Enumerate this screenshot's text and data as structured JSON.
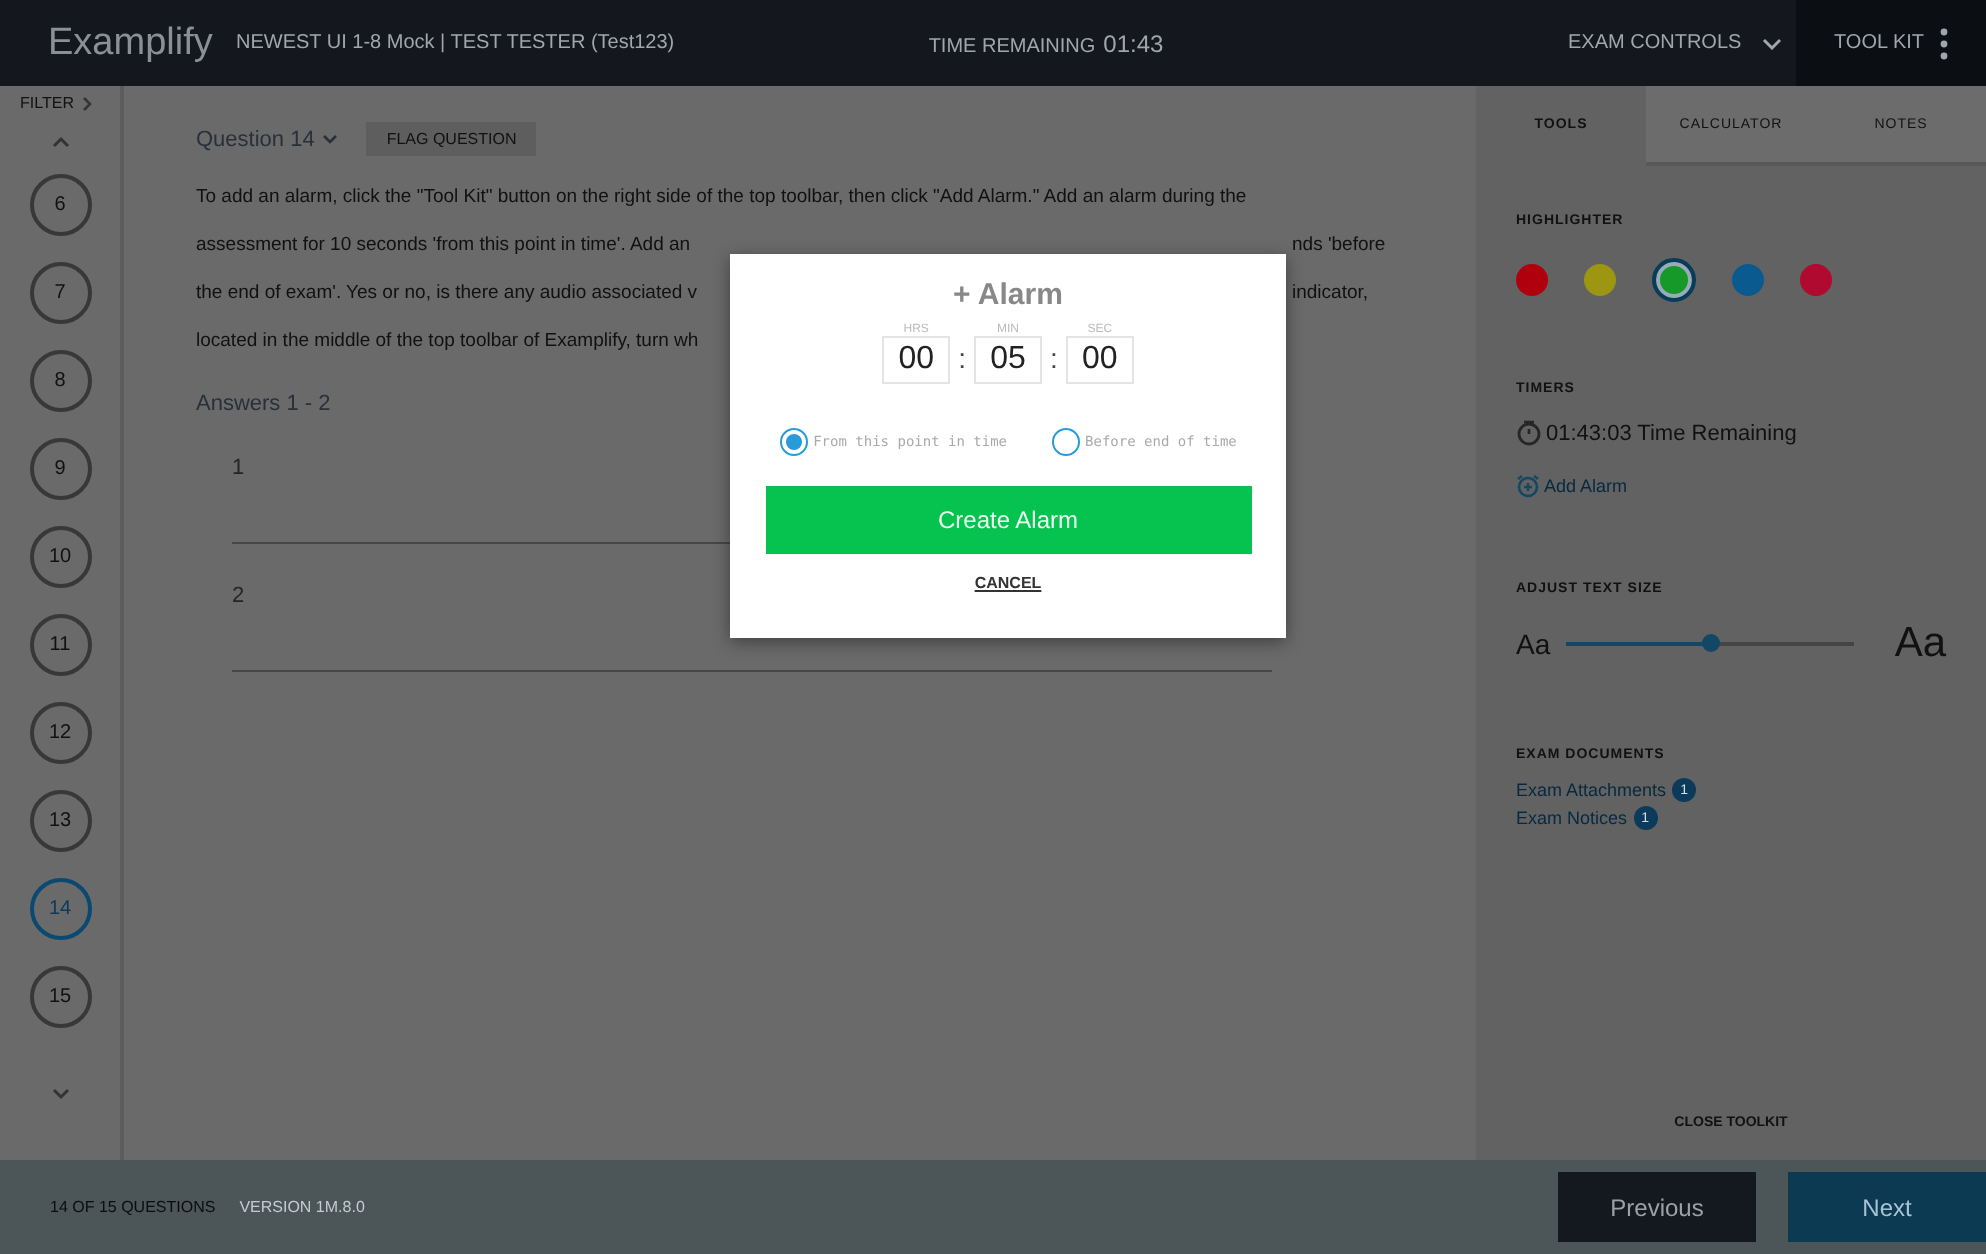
{
  "header": {
    "logo": "Examplify",
    "exam_title": "NEWEST UI 1-8 Mock | TEST TESTER (Test123)",
    "time_label": "TIME REMAINING",
    "time": "01:43",
    "exam_controls": "EXAM CONTROLS",
    "toolkit": "TOOL KIT"
  },
  "nav": {
    "filter": "FILTER",
    "questions": [
      {
        "number": "6",
        "selected": false
      },
      {
        "number": "7",
        "selected": false
      },
      {
        "number": "8",
        "selected": false
      },
      {
        "number": "9",
        "selected": false
      },
      {
        "number": "10",
        "selected": false
      },
      {
        "number": "11",
        "selected": false
      },
      {
        "number": "12",
        "selected": false
      },
      {
        "number": "13",
        "selected": false
      },
      {
        "number": "14",
        "selected": true
      },
      {
        "number": "15",
        "selected": false
      }
    ]
  },
  "question": {
    "title": "Question 14",
    "flag": "FLAG QUESTION",
    "lines": [
      {
        "left": "To add an alarm, click the \"Tool Kit\" button on the right side of the top toolbar, then click \"Add Alarm.\" Add an alarm during the"
      },
      {
        "left": "assessment for 10 seconds 'from this point in time'. Add an",
        "right": "nds 'before"
      },
      {
        "left": "the end of exam'. Yes or no, is there any audio associated v",
        "right": "indicator,"
      },
      {
        "left": "located in the middle of the top toolbar of Examplify, turn wh"
      }
    ],
    "answers_title": "Answers 1 - 2",
    "answers": [
      "1",
      "2"
    ]
  },
  "modal": {
    "title": "+ Alarm",
    "fields": [
      {
        "label": "HRS",
        "value": "00"
      },
      {
        "label": "MIN",
        "value": "05"
      },
      {
        "label": "SEC",
        "value": "00"
      }
    ],
    "separators": [
      ":",
      ":"
    ],
    "options": [
      {
        "label": "From this point in time",
        "selected": true
      },
      {
        "label": "Before end of time",
        "selected": false
      }
    ],
    "create": "Create Alarm",
    "cancel": "CANCEL"
  },
  "toolkit": {
    "tabs": [
      {
        "label": "TOOLS",
        "selected": true
      },
      {
        "label": "CALCULATOR",
        "selected": false
      },
      {
        "label": "NOTES",
        "selected": false
      }
    ],
    "highlighter": {
      "title": "HIGHLIGHTER",
      "colors": [
        {
          "color": "#b0000e",
          "selected": false
        },
        {
          "color": "#9c9610",
          "selected": false
        },
        {
          "color": "#17992a",
          "selected": true
        },
        {
          "color": "#0a5a90",
          "selected": false
        },
        {
          "color": "#b00a30",
          "selected": false
        }
      ]
    },
    "timers": {
      "title": "TIMERS",
      "timer": "01:43:03 Time Remaining",
      "add_alarm": "Add Alarm"
    },
    "text_size": {
      "title": "ADJUST TEXT SIZE",
      "small": "Aa",
      "large": "Aa",
      "level": 0.5
    },
    "documents": {
      "title": "EXAM DOCUMENTS",
      "links": [
        {
          "label": "Exam Attachments",
          "count": "1"
        },
        {
          "label": "Exam Notices",
          "count": "1"
        }
      ]
    },
    "close": "CLOSE TOOLKIT"
  },
  "footer": {
    "progress": "14 OF 15 QUESTIONS",
    "version": "VERSION 1M.8.0",
    "previous": "Previous",
    "next": "Next"
  }
}
